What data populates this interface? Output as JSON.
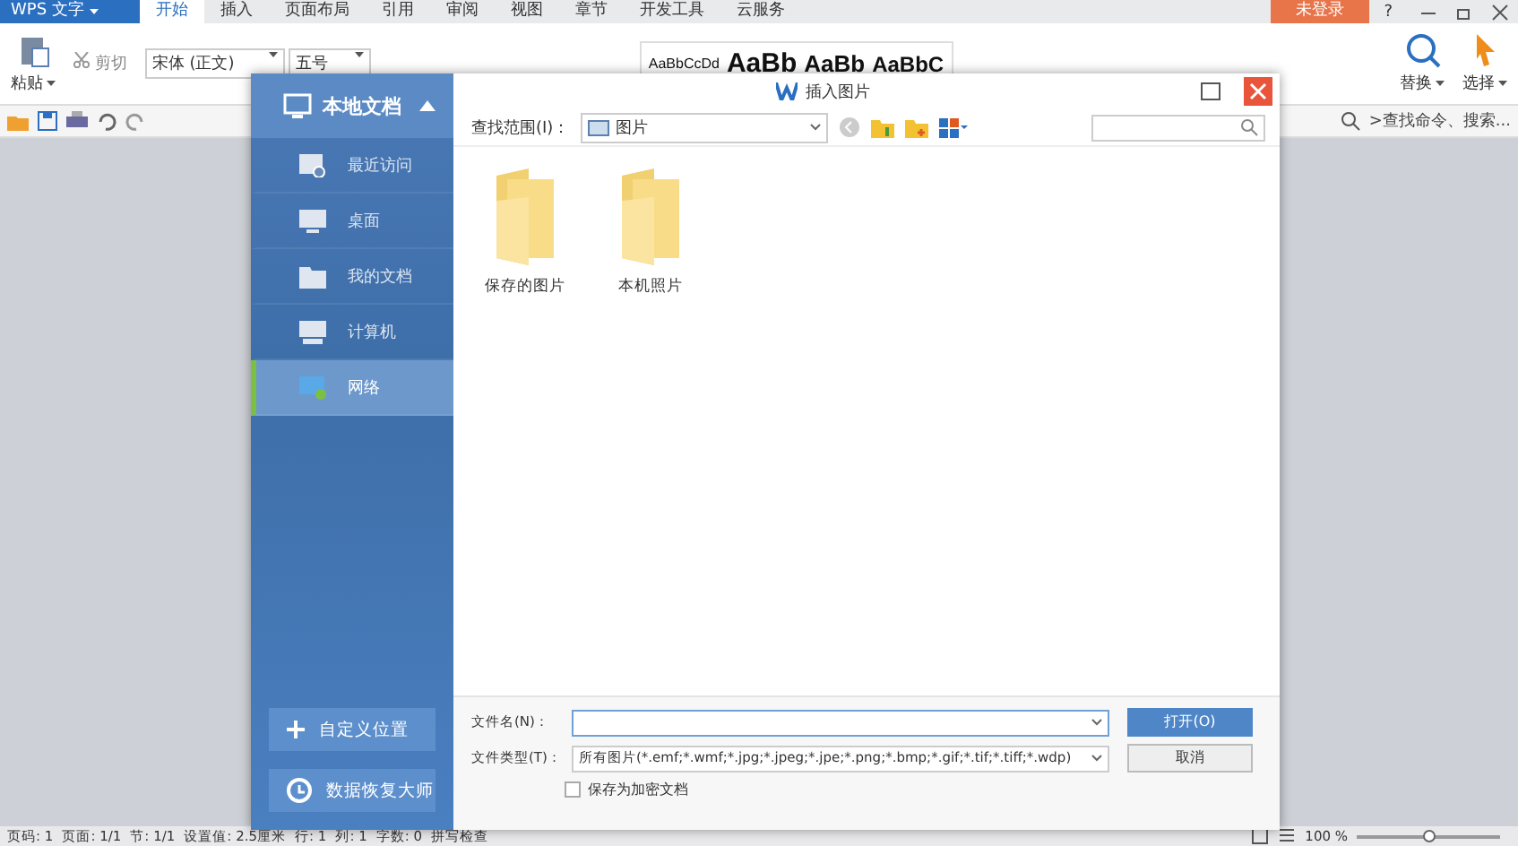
{
  "app": {
    "name": "WPS 文字",
    "login": "未登录",
    "help": "?"
  },
  "menu_tabs": [
    {
      "label": "开始",
      "selected": true
    },
    {
      "label": "插入",
      "selected": false
    },
    {
      "label": "页面布局",
      "selected": false
    },
    {
      "label": "引用",
      "selected": false
    },
    {
      "label": "审阅",
      "selected": false
    },
    {
      "label": "视图",
      "selected": false
    },
    {
      "label": "章节",
      "selected": false
    },
    {
      "label": "开发工具",
      "selected": false
    },
    {
      "label": "云服务",
      "selected": false
    }
  ],
  "ribbon": {
    "paste": "粘贴",
    "cut": "剪切",
    "font": "宋体 (正文)",
    "size": "五号",
    "styles": [
      "AaBbCcDd",
      "AaBb",
      "AaBb",
      "AaBbC"
    ],
    "replace": "替换",
    "select": "选择"
  },
  "quick_bar": {
    "search": ">查找命令、搜索..."
  },
  "dialog": {
    "sidebar_title": "本地文档",
    "places": [
      {
        "label": "最近访问",
        "kind": "recent",
        "selected": false
      },
      {
        "label": "桌面",
        "kind": "desktop",
        "selected": false
      },
      {
        "label": "我的文档",
        "kind": "documents",
        "selected": false
      },
      {
        "label": "计算机",
        "kind": "computer",
        "selected": false
      },
      {
        "label": "网络",
        "kind": "network",
        "selected": true
      }
    ],
    "custom": "自定义位置",
    "recover": "数据恢复大师",
    "title": "插入图片",
    "look_in_label": "查找范围(I)：",
    "look_in": "图片",
    "items": [
      "保存的图片",
      "本机照片"
    ],
    "filename_label": "文件名(N)：",
    "filetype_label": "文件类型(T)：",
    "filetype": "所有图片(*.emf;*.wmf;*.jpg;*.jpeg;*.jpe;*.png;*.bmp;*.gif;*.tif;*.tiff;*.wdp)",
    "encrypt": {
      "label": "保存为加密文档",
      "checked": false
    },
    "open": "打开(O)",
    "cancel": "取消"
  },
  "status_bar": {
    "items": [
      "页码: 1",
      "页面: 1/1",
      "节: 1/1",
      "设置值: 2.5厘米",
      "行: 1",
      "列: 1",
      "字数: 0",
      "拼写检查"
    ],
    "zoom": "100 %",
    "zoom_slider": {
      "level": 0.5
    }
  }
}
